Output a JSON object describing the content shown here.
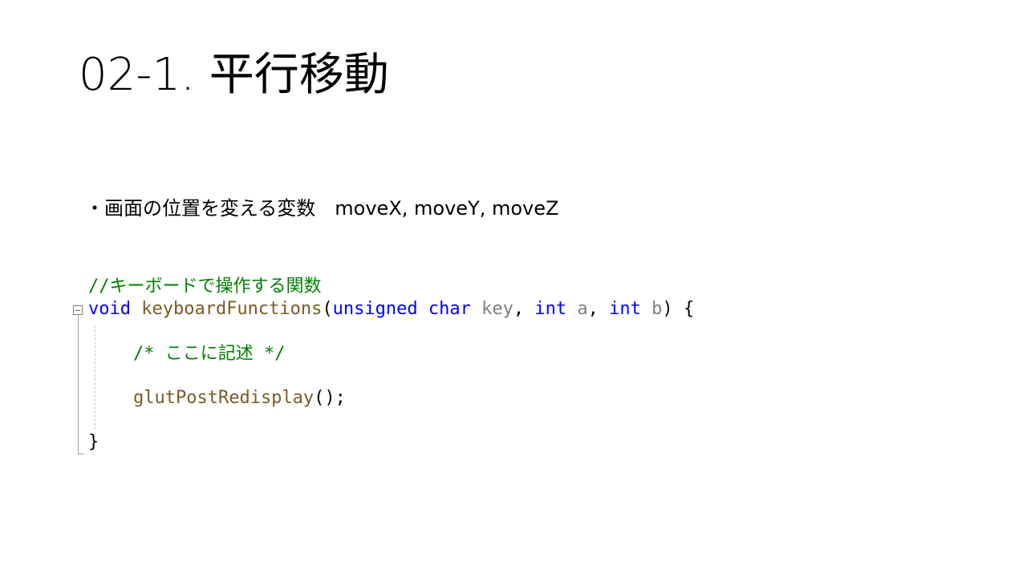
{
  "slide": {
    "title": "02-1. 平行移動",
    "bullet": {
      "text": "・画面の位置を変える変数",
      "variables": "moveX, moveY, moveZ"
    }
  },
  "code": {
    "comment_header": "//キーボードで操作する関数",
    "signature": {
      "kw_void": "void",
      "func_name": " keyboardFunctions",
      "paren_open": "(",
      "kw_unsigned_char": "unsigned char",
      "param_key": " key",
      "sep1": ", ",
      "kw_int1": "int",
      "param_a": " a",
      "sep2": ", ",
      "kw_int2": "int",
      "param_b": " b",
      "tail": ") {"
    },
    "body_comment": "/* ここに記述 */",
    "call": {
      "func": "glutPostRedisplay",
      "tail": "();"
    },
    "closing_brace": "}"
  },
  "colors": {
    "comment": "#008000",
    "keyword": "#0000ff",
    "function": "#7b5a26",
    "parameter": "#808080"
  }
}
